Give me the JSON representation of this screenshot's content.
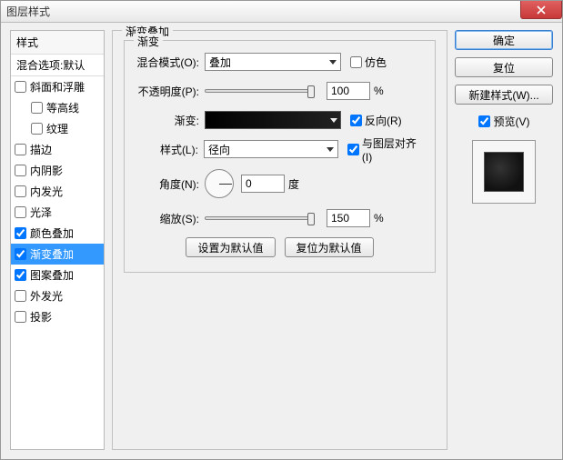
{
  "window": {
    "title": "图层样式"
  },
  "left": {
    "header": "样式",
    "blend_default": "混合选项:默认",
    "items": [
      {
        "label": "斜面和浮雕",
        "checked": false,
        "sub": false
      },
      {
        "label": "等高线",
        "checked": false,
        "sub": true
      },
      {
        "label": "纹理",
        "checked": false,
        "sub": true
      },
      {
        "label": "描边",
        "checked": false,
        "sub": false
      },
      {
        "label": "内阴影",
        "checked": false,
        "sub": false
      },
      {
        "label": "内发光",
        "checked": false,
        "sub": false
      },
      {
        "label": "光泽",
        "checked": false,
        "sub": false
      },
      {
        "label": "颜色叠加",
        "checked": true,
        "sub": false
      },
      {
        "label": "渐变叠加",
        "checked": true,
        "sub": false,
        "selected": true
      },
      {
        "label": "图案叠加",
        "checked": true,
        "sub": false
      },
      {
        "label": "外发光",
        "checked": false,
        "sub": false
      },
      {
        "label": "投影",
        "checked": false,
        "sub": false
      }
    ]
  },
  "panel": {
    "outer_title": "渐变叠加",
    "inner_title": "渐变",
    "blend_mode_label": "混合模式(O):",
    "blend_mode_value": "叠加",
    "dither_label": "仿色",
    "opacity_label": "不透明度(P):",
    "opacity_value": "100",
    "percent": "%",
    "gradient_label": "渐变:",
    "reverse_label": "反向(R)",
    "style_label": "样式(L):",
    "style_value": "径向",
    "align_label": "与图层对齐(I)",
    "angle_label": "角度(N):",
    "angle_value": "0",
    "angle_unit": "度",
    "scale_label": "缩放(S):",
    "scale_value": "150",
    "set_default": "设置为默认值",
    "reset_default": "复位为默认值"
  },
  "right": {
    "ok": "确定",
    "cancel": "复位",
    "new_style": "新建样式(W)...",
    "preview_label": "预览(V)"
  }
}
